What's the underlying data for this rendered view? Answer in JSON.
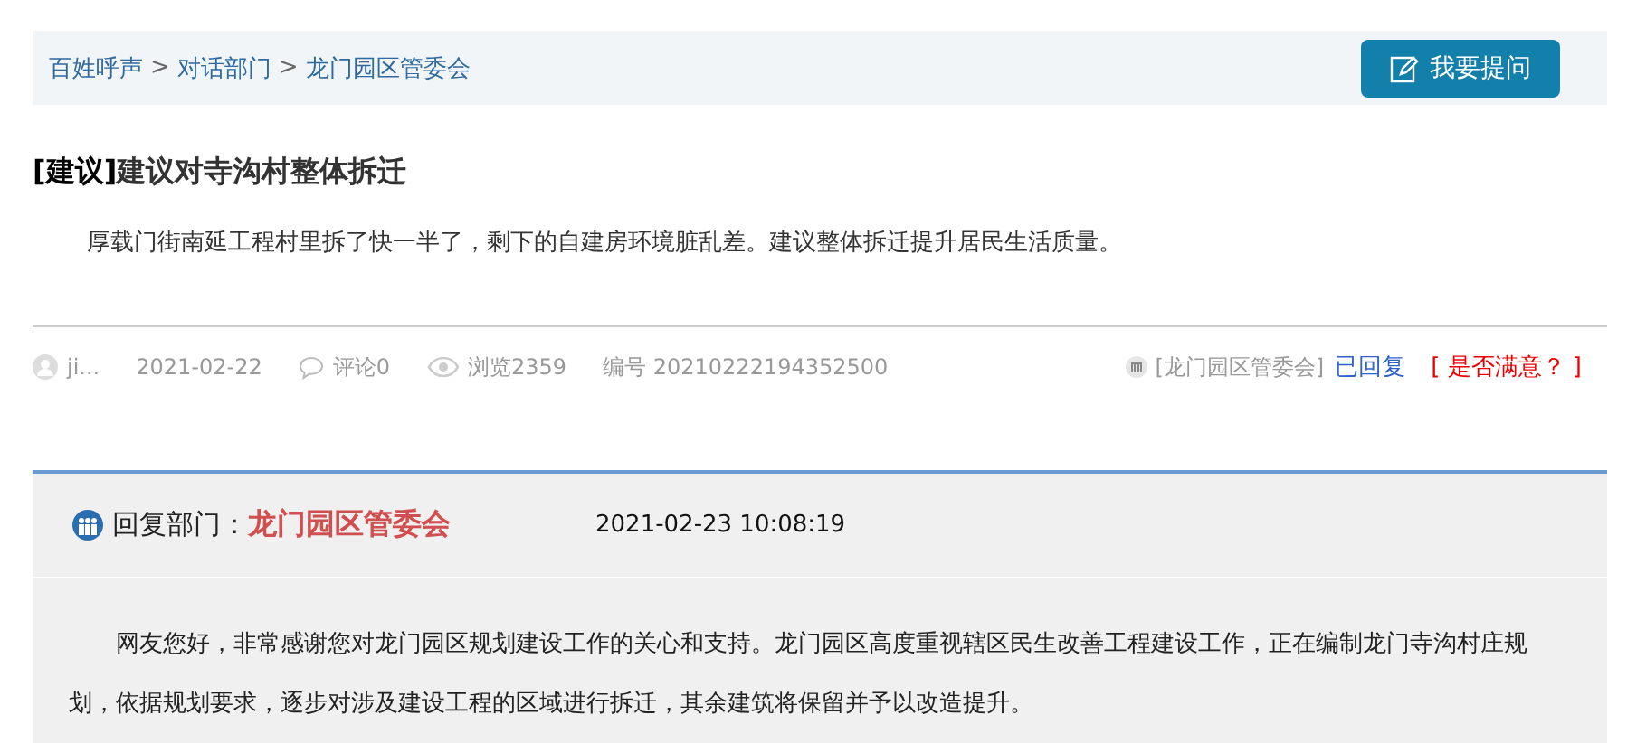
{
  "breadcrumb": [
    "百姓呼声",
    "对话部门",
    "龙门园区管委会"
  ],
  "breadcrumb_separator": ">",
  "ask_button": "我要提问",
  "post": {
    "category": "[建议]",
    "title": "建议对寺沟村整体拆迁",
    "body": "厚载门街南延工程村里拆了快一半了，剩下的自建房环境脏乱差。建议整体拆迁提升居民生活质量。",
    "author": "ji...",
    "date": "2021-02-22",
    "comments": "评论0",
    "views": "浏览2359",
    "number_label": "编号",
    "number": "20210222194352500",
    "department": "[龙门园区管委会]",
    "status": "已回复",
    "satisfaction": "[ 是否满意？ ]"
  },
  "reply": {
    "label": "回复部门：",
    "department": "龙门园区管委会",
    "time": "2021-02-23 10:08:19",
    "text": "网友您好，非常感谢您对龙门园区规划建设工作的关心和支持。龙门园区高度重视辖区民生改善工程建设工作，正在编制龙门寺沟村庄规划，依据规划要求，逐步对涉及建设工程的区域进行拆迁，其余建筑将保留并予以改造提升。"
  }
}
